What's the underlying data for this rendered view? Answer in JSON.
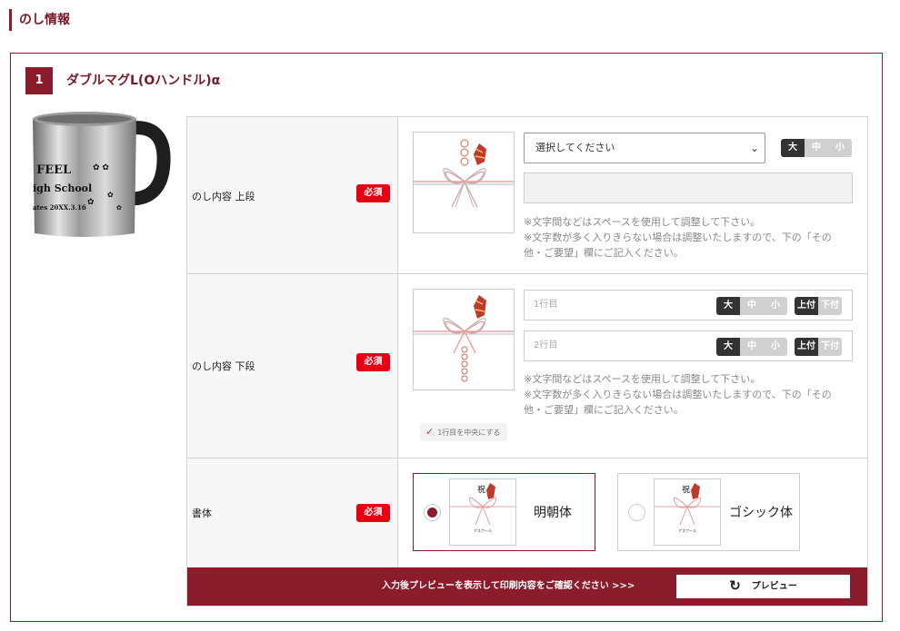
{
  "section": {
    "title": "のし情報"
  },
  "item": {
    "number": "1",
    "name": "ダブルマグL(Oハンドル)α"
  },
  "product_image": {
    "lines": [
      "FEEL",
      "igh School",
      "ates 20XX.3.16"
    ]
  },
  "rows": {
    "upper": {
      "label": "のし内容 上段",
      "required": "必須",
      "select_value": "選択してください",
      "sizes": [
        "大",
        "中",
        "小"
      ],
      "selected_size": "大",
      "notes": [
        "※文字間などはスペースを使用して調整して下さい。",
        "※文字数が多く入りきらない場合は調整いたしますので、下の「その他・ご要望」欄にご記入ください。"
      ]
    },
    "lower": {
      "label": "のし内容 下段",
      "required": "必須",
      "line1_placeholder": "1行目",
      "line2_placeholder": "2行目",
      "sizes": [
        "大",
        "中",
        "小"
      ],
      "positions": [
        "上付",
        "下付"
      ],
      "notes": [
        "※文字間などはスペースを使用して調整して下さい。",
        "※文字数が多く入りきらない場合は調整いたしますので、下の「その他・ご要望」欄にご記入ください。"
      ],
      "center_checkbox": "1行目を中央にする"
    },
    "font": {
      "label": "書体",
      "required": "必須",
      "options": [
        {
          "label": "明朝体",
          "thumb_top": "祝",
          "thumb_bottom": "アスワール",
          "selected": true
        },
        {
          "label": "ゴシック体",
          "thumb_top": "祝",
          "thumb_bottom": "アスワール",
          "selected": false
        }
      ]
    }
  },
  "preview": {
    "message": "入力後プレビューを表示して印刷内容をご確認ください >>>",
    "button_label": "プレビュー"
  },
  "colors": {
    "accent": "#8a1c2b",
    "required": "#e60012"
  }
}
